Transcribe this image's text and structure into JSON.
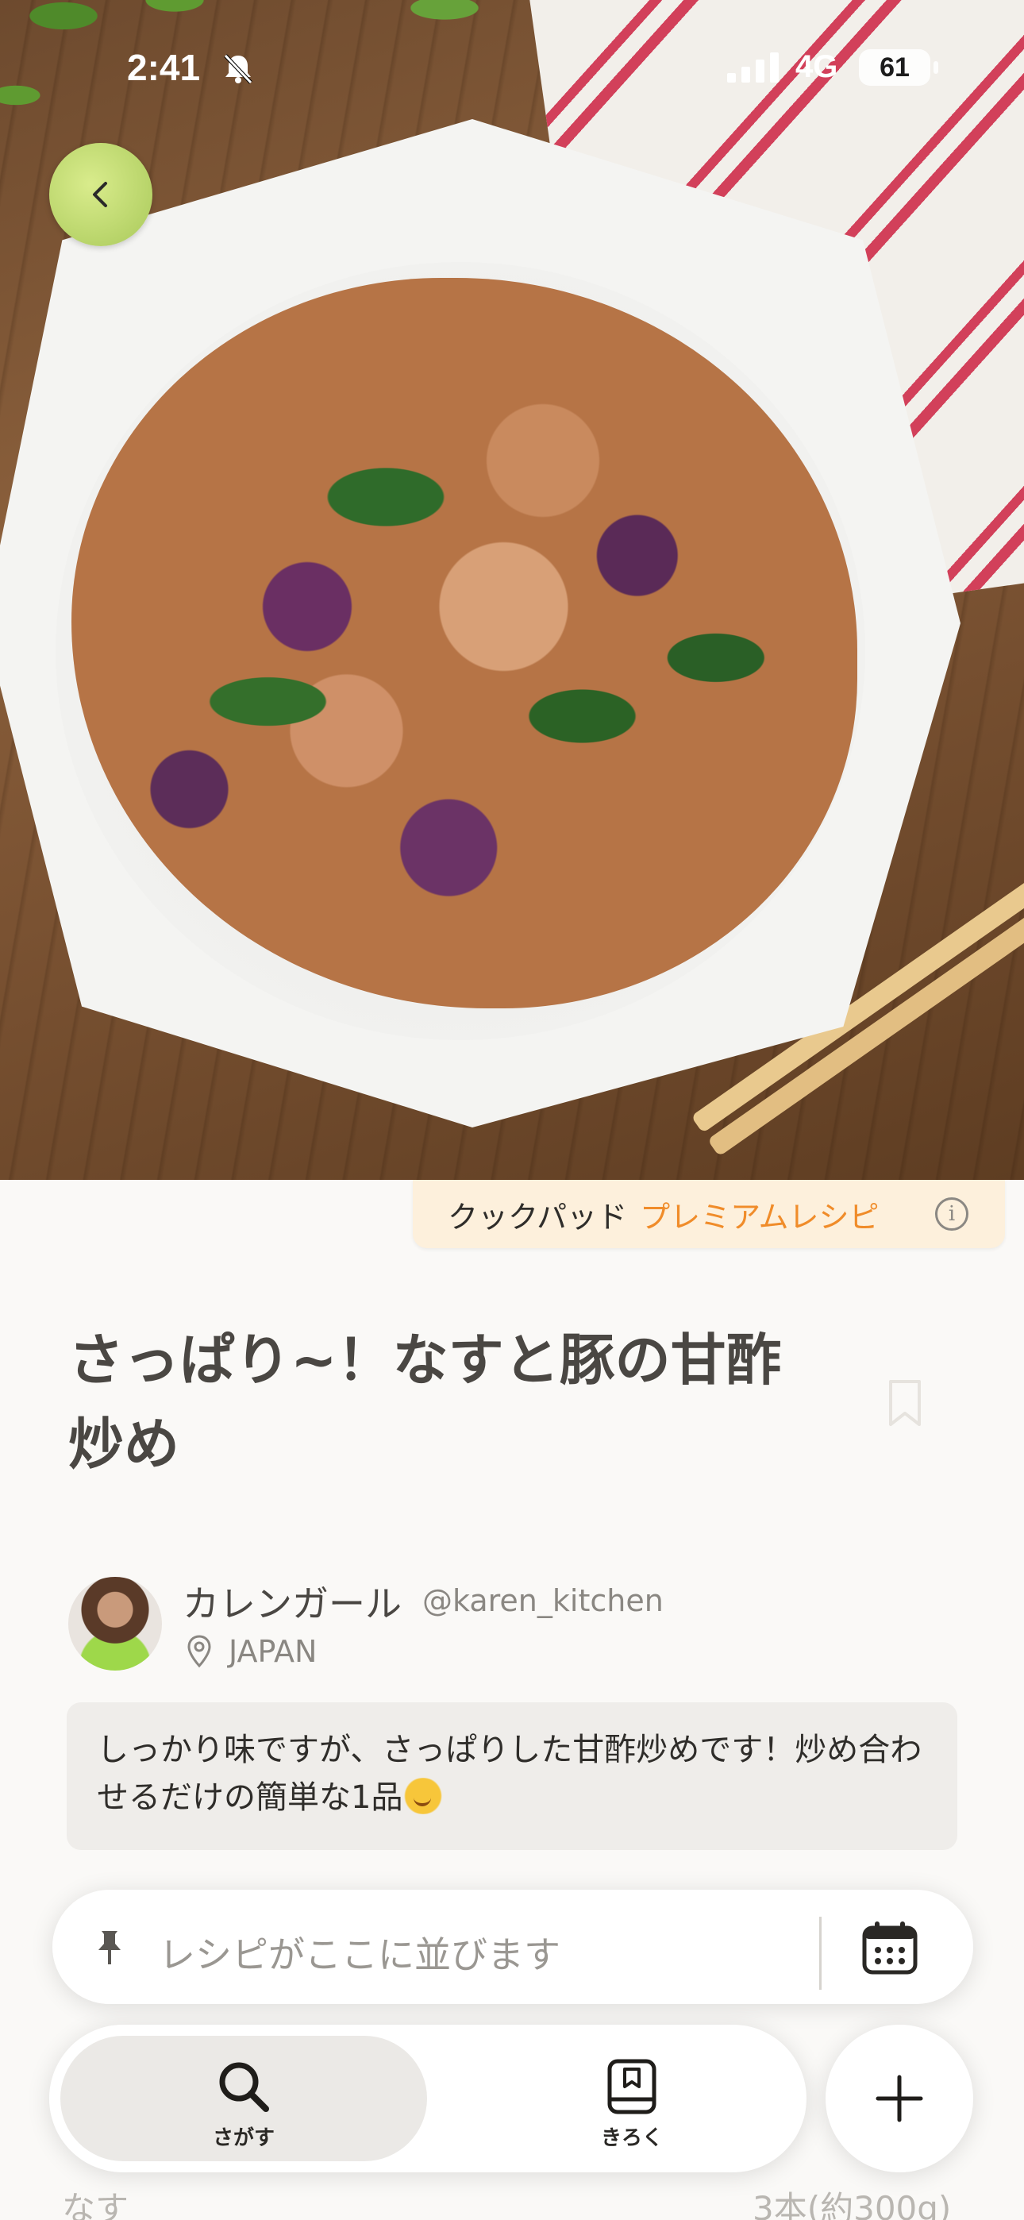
{
  "status_bar": {
    "time": "2:41",
    "network": "4G",
    "battery": "61"
  },
  "premium_banner": {
    "brand": "クックパッド",
    "label": "プレミアムレシピ",
    "info": "i"
  },
  "recipe": {
    "title_line1": "さっぱり~！なすと豚の甘酢",
    "title_line2": "炒め",
    "description": "しっかり味ですが、さっぱりした甘酢炒めです！炒め合わせるだけの簡単な1品"
  },
  "author": {
    "name": "カレンガール",
    "handle": "@karen_kitchen",
    "location": "JAPAN"
  },
  "recipe_bar": {
    "placeholder": "レシピがここに並びます"
  },
  "ingredients_preview": {
    "name": "なす",
    "quantity": "3本(約300g)"
  },
  "nav": {
    "search_label": "さがす",
    "record_label": "きろく"
  },
  "icons": {
    "back": "chevron-left-icon",
    "bell_off": "bell-slash-icon",
    "bookmark": "bookmark-icon",
    "location": "location-pin-icon",
    "pin": "pushpin-icon",
    "calendar": "calendar-icon",
    "search": "search-icon",
    "record": "notebook-icon",
    "add": "plus-icon"
  },
  "colors": {
    "accent": "#f08c2a",
    "premium_bg": "#fdf0dc",
    "text": "#4a4743"
  }
}
